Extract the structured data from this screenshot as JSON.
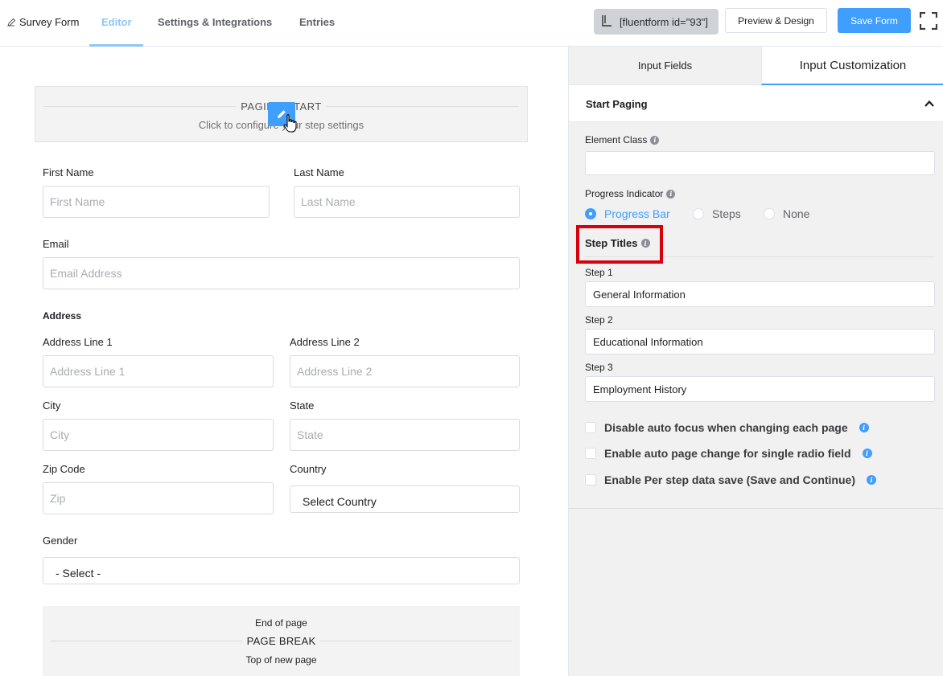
{
  "header": {
    "form_name": "Survey Form",
    "tabs": [
      {
        "label": "Editor",
        "active": true
      },
      {
        "label": "Settings & Integrations",
        "active": false
      },
      {
        "label": "Entries",
        "active": false
      }
    ],
    "shortcode": "[fluentform id=\"93\"]",
    "preview_label": "Preview & Design",
    "save_label": "Save Form"
  },
  "editor": {
    "page_start": {
      "title": "PAGING START",
      "subtitle": "Click to configure your step settings"
    },
    "fields": {
      "first_name": {
        "label": "First Name",
        "placeholder": "First Name"
      },
      "last_name": {
        "label": "Last Name",
        "placeholder": "Last Name"
      },
      "email": {
        "label": "Email",
        "placeholder": "Email Address"
      },
      "address_heading": "Address",
      "address_line_1": {
        "label": "Address Line 1",
        "placeholder": "Address Line 1"
      },
      "address_line_2": {
        "label": "Address Line 2",
        "placeholder": "Address Line 2"
      },
      "city": {
        "label": "City",
        "placeholder": "City"
      },
      "state": {
        "label": "State",
        "placeholder": "State"
      },
      "zip": {
        "label": "Zip Code",
        "placeholder": "Zip"
      },
      "country": {
        "label": "Country",
        "value": "Select Country"
      },
      "gender": {
        "label": "Gender",
        "value": "- Select -"
      }
    },
    "page_break": {
      "top": "End of page",
      "title": "PAGE BREAK",
      "bottom": "Top of new page"
    }
  },
  "sidebar": {
    "tabs": [
      {
        "label": "Input Fields",
        "active": false
      },
      {
        "label": "Input Customization",
        "active": true
      }
    ],
    "section_title": "Start Paging",
    "element_class": {
      "label": "Element Class",
      "value": ""
    },
    "progress_indicator": {
      "label": "Progress Indicator",
      "options": [
        {
          "label": "Progress Bar",
          "selected": true
        },
        {
          "label": "Steps",
          "selected": false
        },
        {
          "label": "None",
          "selected": false
        }
      ]
    },
    "step_titles": {
      "label": "Step Titles",
      "steps": [
        {
          "label": "Step 1",
          "value": "General Information"
        },
        {
          "label": "Step 2",
          "value": "Educational Information"
        },
        {
          "label": "Step 3",
          "value": "Employment History"
        }
      ]
    },
    "checkboxes": [
      {
        "label": "Disable auto focus when changing each page",
        "checked": false
      },
      {
        "label": "Enable auto page change for single radio field",
        "checked": false
      },
      {
        "label": "Enable Per step data save (Save and Continue)",
        "checked": false
      }
    ]
  },
  "colors": {
    "primary": "#409eff",
    "highlight_border": "#d6000e",
    "active_tab": "#8ec5f5"
  }
}
